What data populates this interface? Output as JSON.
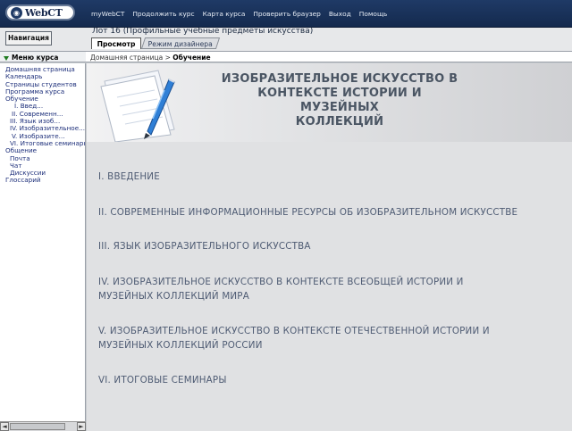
{
  "app": {
    "logo_text": "WebCT"
  },
  "topnav": [
    "myWebCT",
    "Продолжить курс",
    "Карта курса",
    "Проверить браузер",
    "Выход",
    "Помощь"
  ],
  "header": {
    "nav_button": "Навигация",
    "course_title": "Лот 16  (Профильные учебные предметы искусства)",
    "tabs": [
      "Просмотр",
      "Режим дизайнера"
    ]
  },
  "sidebar": {
    "title": "Меню курса",
    "items": [
      "Домашняя страница",
      "Календарь",
      "Страницы студентов",
      "Программа курса",
      "Обучение",
      "I. Введ...",
      "II. Современн...",
      "III. Язык изоб...",
      "IV. Изобразительное...",
      "V. Изобразите...",
      "VI. Итоговые семинары",
      "Общение",
      "Почта",
      "Чат",
      "Дискуссии",
      "Глоссарий"
    ]
  },
  "breadcrumb": {
    "home": "Домашняя страница",
    "separator": ">",
    "current": "Обучение"
  },
  "main": {
    "title_lines": [
      "ИЗОБРАЗИТЕЛЬНОЕ ИСКУССТВО В",
      "КОНТЕКСТЕ ИСТОРИИ И МУЗЕЙНЫХ",
      "КОЛЛЕКЦИЙ"
    ],
    "toc": [
      [
        "I. ВВЕДЕНИЕ"
      ],
      [
        "II. СОВРЕМЕННЫЕ ИНФОРМАЦИОННЫЕ РЕСУРСЫ ОБ ИЗОБРАЗИТЕЛЬНОМ ИСКУССТВЕ"
      ],
      [
        "III. ЯЗЫК ИЗОБРАЗИТЕЛЬНОГО ИСКУССТВА"
      ],
      [
        "IV. ИЗОБРАЗИТЕЛЬНОЕ ИСКУССТВО В КОНТЕКСТЕ ВСЕОБЩЕЙ ИСТОРИИ И",
        "МУЗЕЙНЫХ КОЛЛЕКЦИЙ МИРА"
      ],
      [
        "V. ИЗОБРАЗИТЕЛЬНОЕ ИСКУССТВО В КОНТЕКСТЕ ОТЕЧЕСТВЕННОЙ ИСТОРИИ И",
        "МУЗЕЙНЫХ КОЛЛЕКЦИЙ РОССИИ"
      ],
      [
        "VI. ИТОГОВЫЕ СЕМИНАРЫ"
      ]
    ]
  },
  "scrollbar": {
    "left_arrow": "◄",
    "right_arrow": "►"
  },
  "colors": {
    "topbar": "#1f3a66",
    "title": "#4a5563",
    "toc": "#4e5b73",
    "sidebar_link": "#1d2f7a"
  }
}
